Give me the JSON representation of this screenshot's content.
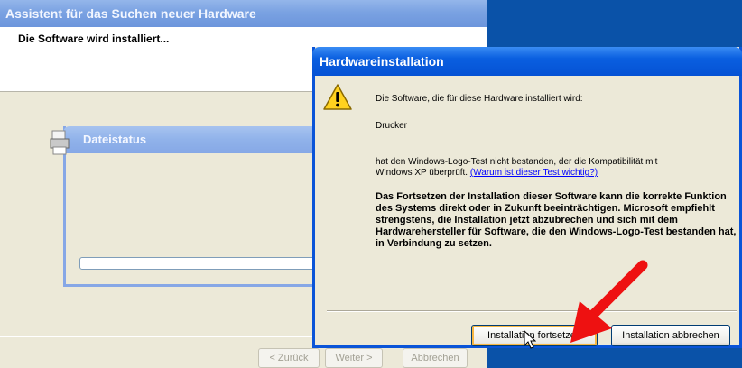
{
  "wizard": {
    "title": "Assistent für das Suchen neuer Hardware",
    "header_text": "Die Software wird installiert...",
    "buttons": {
      "back": "< Zurück",
      "next": "Weiter >",
      "cancel": "Abbrechen"
    }
  },
  "file_status": {
    "title": "Dateistatus",
    "progress": 0
  },
  "dialog": {
    "title": "Hardwareinstallation",
    "line1": "Die Software, die für diese Hardware installiert wird:",
    "device": "Drucker",
    "line2a": "hat den Windows-Logo-Test nicht bestanden, der die Kompatibilität mit",
    "line2b": "Windows XP überprüft.",
    "link": "(Warum ist dieser Test wichtig?)",
    "warning": "Das Fortsetzen der Installation dieser Software kann die korrekte Funktion des Systems direkt oder in Zukunft beeinträchtigen. Microsoft empfiehlt strengstens, die Installation jetzt abzubrechen und sich mit dem Hardwarehersteller für Software, die den Windows-Logo-Test bestanden hat, in Verbindung zu setzen.",
    "buttons": {
      "continue": "Installation fortsetzen",
      "abort": "Installation abbrechen"
    }
  },
  "icons": {
    "warning": "warning-icon",
    "printer": "printer-icon",
    "cursor": "mouse-cursor-icon",
    "annotation": "red-arrow-icon"
  },
  "colors": {
    "desktop": "#0a52a8",
    "titlebar_active": "#0552d4",
    "titlebar_inactive": "#7aa2e2",
    "dialog_bg": "#ece9d8",
    "link": "#0000ff",
    "annotation": "#ee1111"
  }
}
